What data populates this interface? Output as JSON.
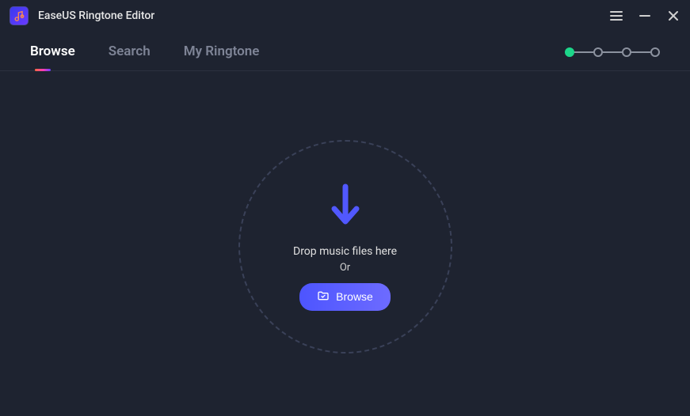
{
  "app": {
    "title": "EaseUS Ringtone Editor"
  },
  "nav": {
    "tabs": [
      {
        "label": "Browse",
        "active": true
      },
      {
        "label": "Search",
        "active": false
      },
      {
        "label": "My Ringtone",
        "active": false
      }
    ]
  },
  "drop": {
    "text": "Drop music files here",
    "or": "Or",
    "browse_label": "Browse"
  }
}
